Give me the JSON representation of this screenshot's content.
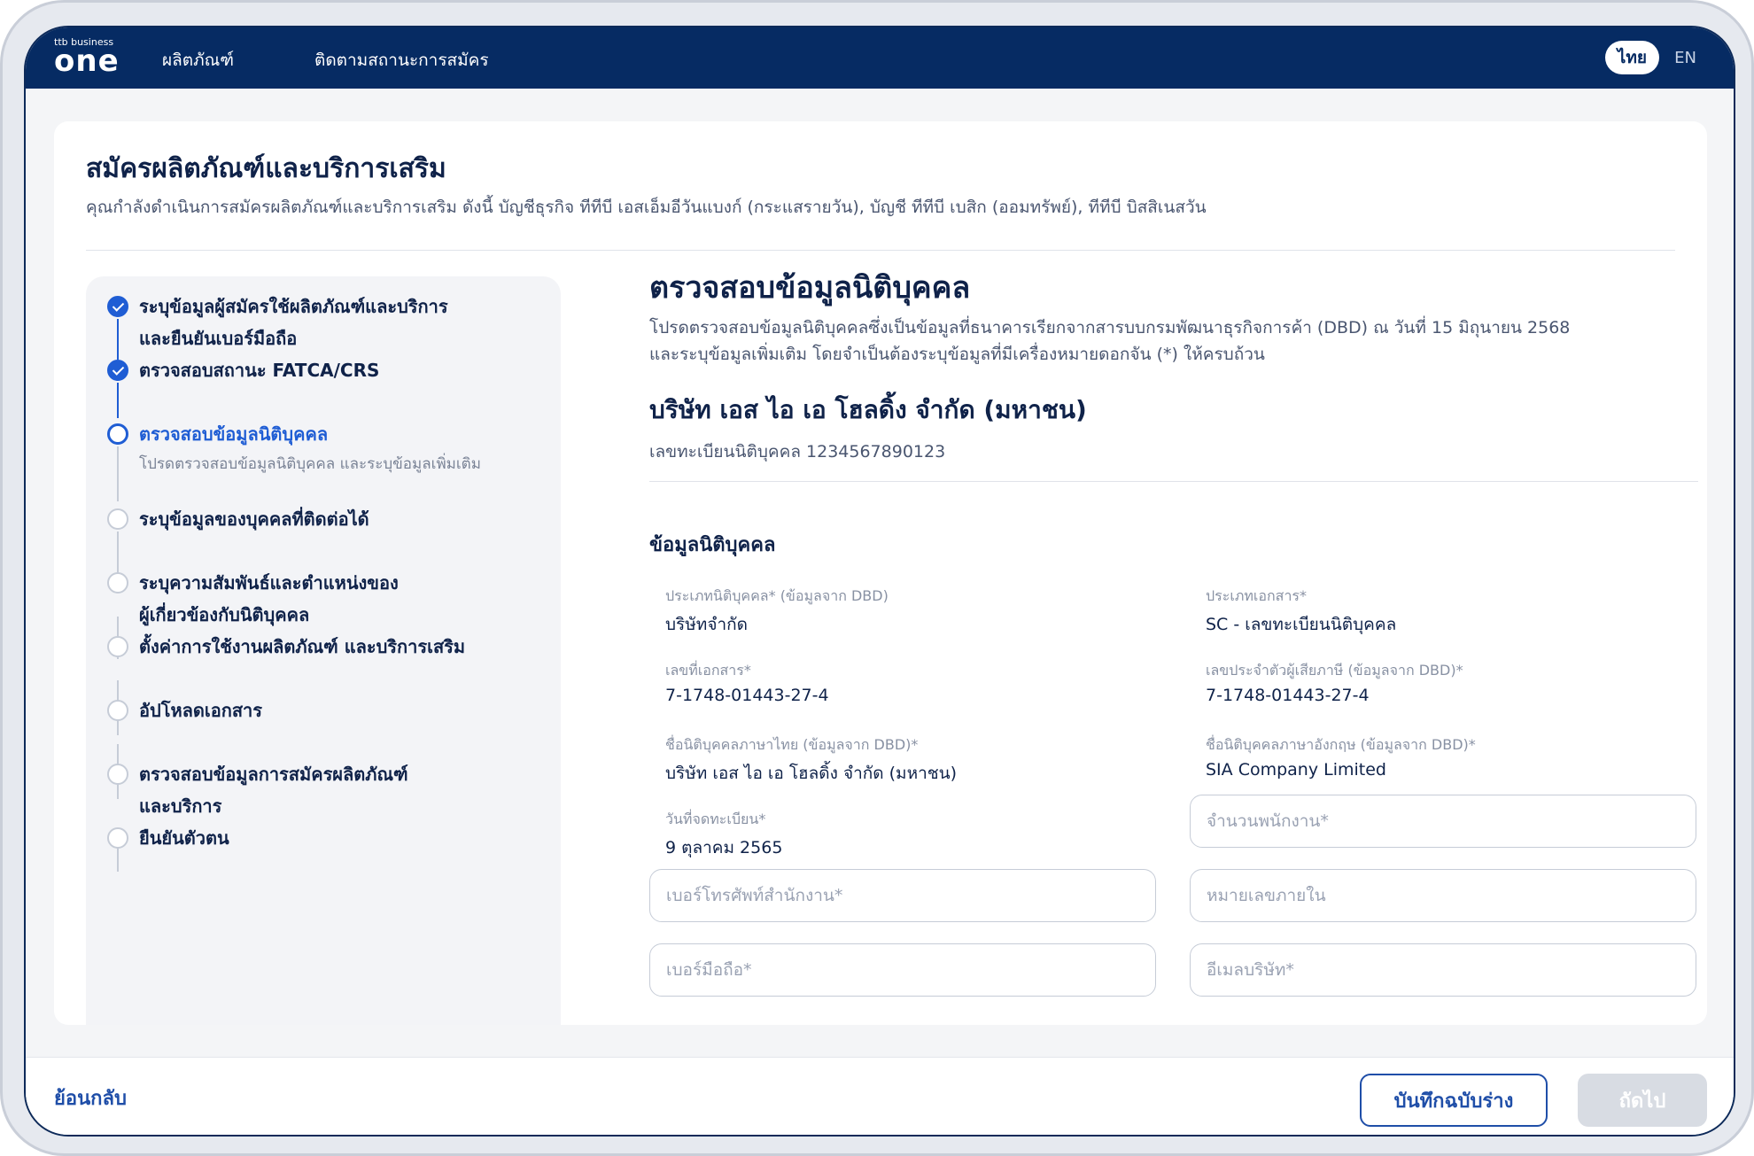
{
  "brand": {
    "small": "ttb business",
    "big": "one"
  },
  "nav": {
    "products": "ผลิตภัณฑ์",
    "track": "ติดตามสถานะการสมัคร",
    "lang_th": "ไทย",
    "lang_en": "EN"
  },
  "page": {
    "title": "สมัครผลิตภัณฑ์และบริการเสริม",
    "subtitle": "คุณกำลังดำเนินการสมัครผลิตภัณฑ์และบริการเสริม ดังนี้  บัญชีธุรกิจ ทีทีบี เอสเอ็มอีวันแบงก์ (กระแสรายวัน),  บัญชี ทีทีบี เบสิก (ออมทรัพย์),  ทีทีบี บิสสิเนสวัน"
  },
  "steps": [
    {
      "label_1": "ระบุข้อมูลผู้สมัครใช้ผลิตภัณฑ์และบริการ",
      "label_2": "และยืนยันเบอร์มือถือ",
      "status": "done"
    },
    {
      "label_1": "ตรวจสอบสถานะ FATCA/CRS",
      "status": "done"
    },
    {
      "label_1": "ตรวจสอบข้อมูลนิติบุคคล",
      "desc": "โปรดตรวจสอบข้อมูลนิติบุคคล และระบุข้อมูลเพิ่มเติม",
      "status": "active"
    },
    {
      "label_1": "ระบุข้อมูลของบุคคลที่ติดต่อได้",
      "status": "pending"
    },
    {
      "label_1": "ระบุความสัมพันธ์และตำแหน่งของ",
      "label_2": "ผู้เกี่ยวข้องกับนิติบุคคล",
      "status": "pending"
    },
    {
      "label_1": "ตั้งค่าการใช้งานผลิตภัณฑ์ และบริการเสริม",
      "status": "pending"
    },
    {
      "label_1": "อัปโหลดเอกสาร",
      "status": "pending"
    },
    {
      "label_1": "ตรวจสอบข้อมูลการสมัครผลิตภัณฑ์",
      "label_2": "และบริการ",
      "status": "pending"
    },
    {
      "label_1": "ยืนยันตัวตน",
      "status": "pending"
    }
  ],
  "section": {
    "title": "ตรวจสอบข้อมูลนิติบุคคล",
    "desc_1": "โปรดตรวจสอบข้อมูลนิติบุคคลซึ่งเป็นข้อมูลที่ธนาคารเรียกจากสารบบกรมพัฒนาธุรกิจการค้า (DBD) ณ วันที่ 15 มิถุนายน 2568",
    "desc_2": "และระบุข้อมูลเพิ่มเติม โดยจำเป็นต้องระบุข้อมูลที่มีเครื่องหมายดอกจัน (*) ให้ครบถ้วน",
    "company_name": "บริษัท เอส ไอ เอ โฮลดิ้ง จำกัด (มหาชน)",
    "reg_no": "เลขทะเบียนนิติบุคคล 1234567890123",
    "info_title": "ข้อมูลนิติบุคคล"
  },
  "fields": {
    "entity_type": {
      "label": "ประเภทนิติบุคคล* (ข้อมูลจาก DBD)",
      "value": "บริษัทจำกัด"
    },
    "doc_type": {
      "label": "ประเภทเอกสาร*",
      "value": "SC - เลขทะเบียนนิติบุคคล"
    },
    "doc_no": {
      "label": "เลขที่เอกสาร*",
      "value": "7-1748-01443-27-4"
    },
    "tax_id": {
      "label": "เลขประจำตัวผู้เสียภาษี (ข้อมูลจาก DBD)*",
      "value": "7-1748-01443-27-4"
    },
    "name_th": {
      "label": "ชื่อนิติบุคคลภาษาไทย (ข้อมูลจาก DBD)*",
      "value": "บริษัท เอส ไอ เอ โฮลดิ้ง จำกัด (มหาชน)"
    },
    "name_en": {
      "label": "ชื่อนิติบุคคลภาษาอังกฤษ (ข้อมูลจาก DBD)*",
      "value": "SIA Company Limited"
    },
    "reg_date": {
      "label": "วันที่จดทะเบียน*",
      "value": "9 ตุลาคม 2565"
    }
  },
  "inputs": {
    "employees": {
      "placeholder": "จำนวนพนักงาน*",
      "value": ""
    },
    "office_phone": {
      "placeholder": "เบอร์โทรศัพท์สำนักงาน*",
      "value": ""
    },
    "extension": {
      "placeholder": "หมายเลขภายใน",
      "value": ""
    },
    "mobile": {
      "placeholder": "เบอร์มือถือ*",
      "value": ""
    },
    "email": {
      "placeholder": "อีเมลบริษัท*",
      "value": ""
    }
  },
  "footer": {
    "back": "ย้อนกลับ",
    "save_draft": "บันทึกฉบับร่าง",
    "next": "ถัดไป"
  },
  "colors": {
    "nav_bg": "#062b63",
    "accent": "#1f5dd4",
    "disabled": "#d8dce3"
  }
}
